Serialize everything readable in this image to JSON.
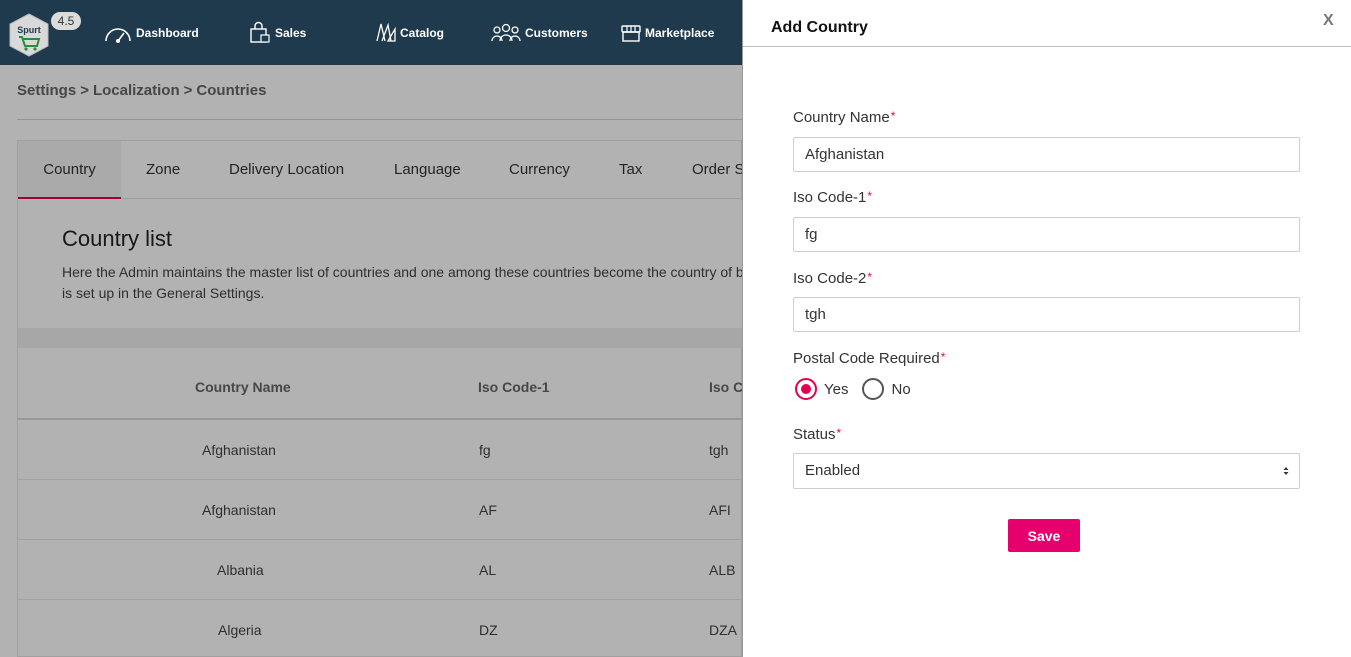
{
  "app": {
    "logo_label": "Spurt",
    "version": "4.5"
  },
  "nav": {
    "items": [
      {
        "label": "Dashboard",
        "icon": "gauge-icon"
      },
      {
        "label": "Sales",
        "icon": "shopping-bag-icon"
      },
      {
        "label": "Catalog",
        "icon": "catalog-icon"
      },
      {
        "label": "Customers",
        "icon": "users-icon"
      },
      {
        "label": "Marketplace",
        "icon": "store-icon"
      }
    ]
  },
  "breadcrumb": [
    "Settings",
    "Localization",
    "Countries"
  ],
  "breadcrumb_separator": ">",
  "tabs": [
    {
      "label": "Country",
      "active": true
    },
    {
      "label": "Zone"
    },
    {
      "label": "Delivery Location"
    },
    {
      "label": "Language"
    },
    {
      "label": "Currency"
    },
    {
      "label": "Tax"
    },
    {
      "label": "Order S"
    }
  ],
  "intro": {
    "title": "Country list",
    "description": "Here the Admin maintains the master list of countries and one among these countries become the country of business that is set up in the General Settings."
  },
  "table": {
    "columns": [
      "Country Name",
      "Iso Code-1",
      "Iso C"
    ],
    "rows": [
      [
        "Afghanistan",
        "fg",
        "tgh"
      ],
      [
        "Afghanistan",
        "AF",
        "AFI"
      ],
      [
        "Albania",
        "AL",
        "ALB"
      ],
      [
        "Algeria",
        "DZ",
        "DZA"
      ]
    ]
  },
  "modal": {
    "title": "Add Country",
    "close_label": "X",
    "required_mark": "*",
    "country_name": {
      "label": "Country Name",
      "value": "Afghanistan"
    },
    "iso_code_1": {
      "label": "Iso Code-1",
      "value": "fg"
    },
    "iso_code_2": {
      "label": "Iso Code-2",
      "value": "tgh"
    },
    "postal_code": {
      "label": "Postal Code Required",
      "options": [
        "Yes",
        "No"
      ],
      "selected": "Yes"
    },
    "status": {
      "label": "Status",
      "value": "Enabled"
    },
    "save_label": "Save"
  },
  "colors": {
    "nav_bg": "#1f3a4d",
    "accent": "#e5004f",
    "button": "#e5006e"
  }
}
